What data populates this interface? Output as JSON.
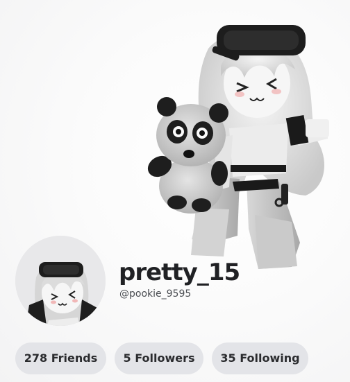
{
  "profile": {
    "display_name": "pretty_15",
    "username": "@pookie_9595"
  },
  "stats": {
    "friends": {
      "count": "278",
      "label": "Friends"
    },
    "followers": {
      "count": "5",
      "label": "Followers"
    },
    "following": {
      "count": "35",
      "label": "Following"
    }
  },
  "colors": {
    "pill_background": "#e3e4e8",
    "text_primary": "#202124",
    "text_secondary": "#4a4d52"
  }
}
